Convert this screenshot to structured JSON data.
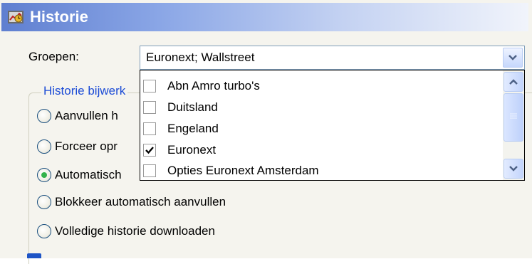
{
  "window": {
    "title": "Historie",
    "title_icon": "history-app-icon"
  },
  "groepen": {
    "label": "Groepen:",
    "value": "Euronext; Wallstreet",
    "dropdown_icon": "chevron-down-icon"
  },
  "group": {
    "legend": "Historie bijwerk"
  },
  "radios": [
    {
      "label": "Aanvullen h",
      "checked": false
    },
    {
      "label": "Forceer opr",
      "checked": false
    },
    {
      "label": "Automatisch",
      "checked": true
    },
    {
      "label": "Blokkeer automatisch aanvullen",
      "checked": false
    },
    {
      "label": "Volledige historie downloaden",
      "checked": false
    }
  ],
  "dropdown": {
    "items": [
      {
        "label": "Abn Amro turbo's",
        "checked": false
      },
      {
        "label": "Duitsland",
        "checked": false
      },
      {
        "label": "Engeland",
        "checked": false
      },
      {
        "label": "Euronext",
        "checked": true
      },
      {
        "label": "Opties Euronext Amsterdam",
        "checked": false
      }
    ],
    "scroll_up_icon": "chevron-up-icon",
    "scroll_down_icon": "chevron-down-icon"
  },
  "colors": {
    "title_bar_start": "#5f7fd0",
    "legend_text": "#1b4bd6",
    "radio_checked": "#33b24b"
  }
}
